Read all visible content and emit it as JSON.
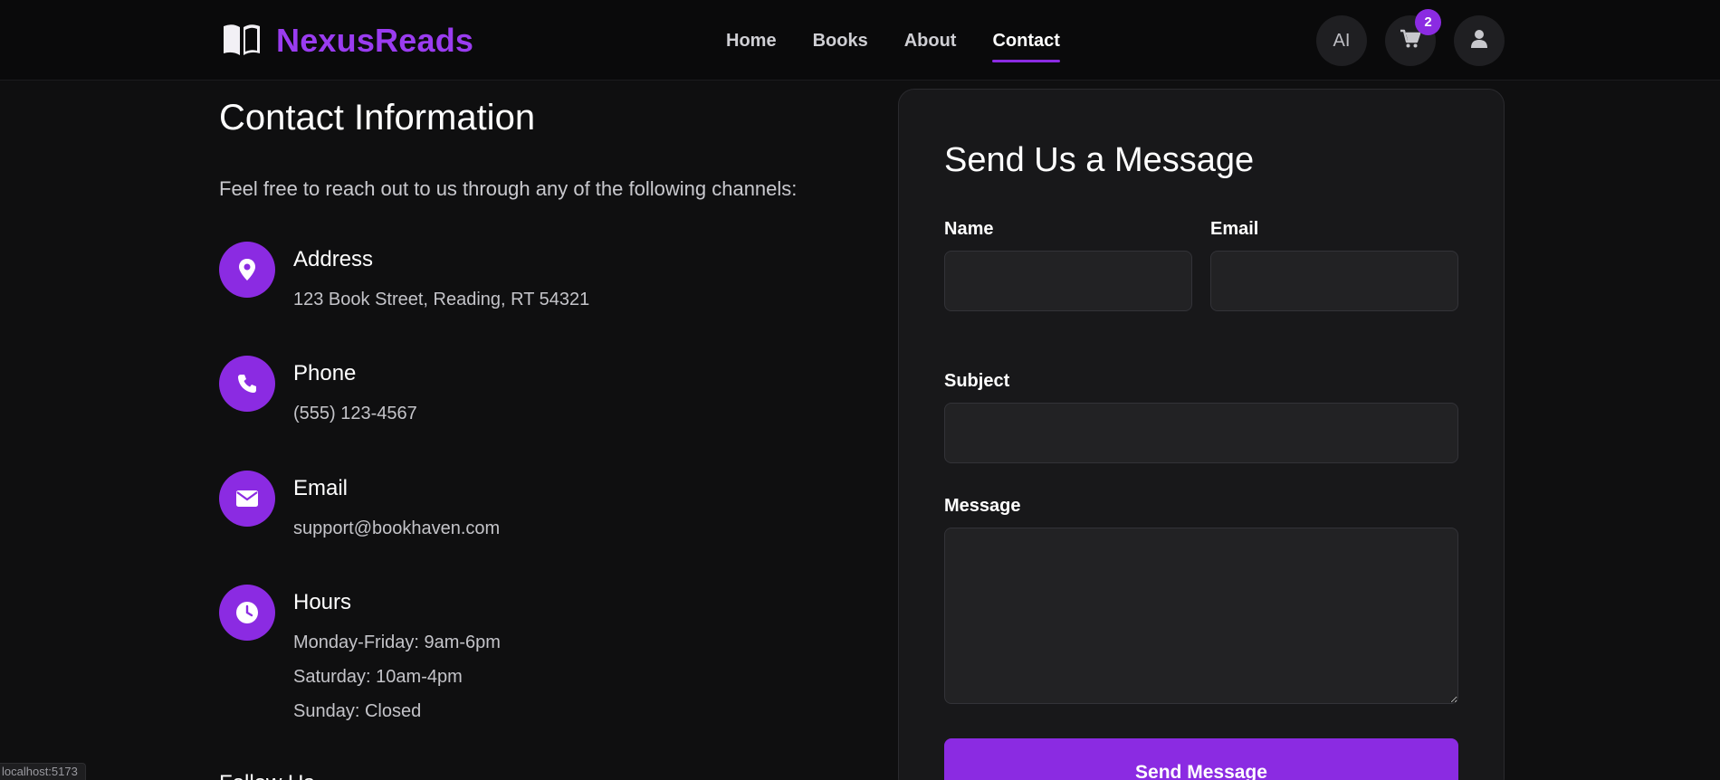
{
  "header": {
    "brand": "NexusReads",
    "nav": [
      {
        "label": "Home"
      },
      {
        "label": "Books"
      },
      {
        "label": "About"
      },
      {
        "label": "Contact",
        "active": true
      }
    ],
    "ai_label": "AI",
    "cart_count": "2"
  },
  "contact": {
    "title": "Contact Information",
    "intro": "Feel free to reach out to us through any of the following channels:",
    "address": {
      "label": "Address",
      "value": "123 Book Street, Reading, RT 54321"
    },
    "phone": {
      "label": "Phone",
      "value": "(555) 123-4567"
    },
    "email": {
      "label": "Email",
      "value": "support@bookhaven.com"
    },
    "hours": {
      "label": "Hours",
      "lines": [
        "Monday-Friday: 9am-6pm",
        "Saturday: 10am-4pm",
        "Sunday: Closed"
      ]
    },
    "follow_title": "Follow Us"
  },
  "form": {
    "title": "Send Us a Message",
    "name_label": "Name",
    "name_value": "",
    "email_label": "Email",
    "email_value": "",
    "subject_label": "Subject",
    "subject_value": "",
    "message_label": "Message",
    "message_value": "",
    "submit_label": "Send Message"
  },
  "status_bar": "localhost:5173",
  "colors": {
    "accent": "#8b2be2",
    "brand": "#9a3cf0",
    "background": "#0f0f10",
    "card": "#18181a"
  }
}
